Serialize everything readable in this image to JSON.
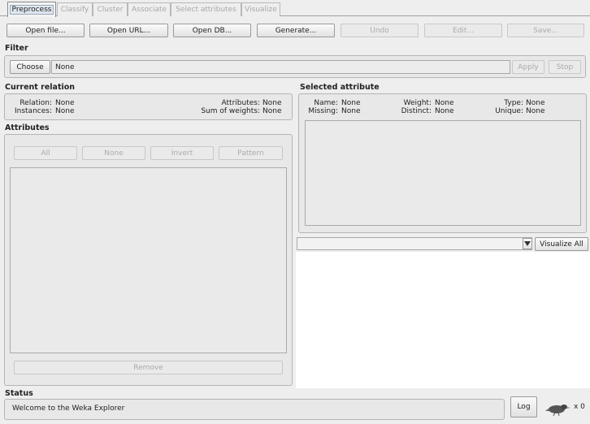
{
  "tabs": [
    "Preprocess",
    "Classify",
    "Cluster",
    "Associate",
    "Select attributes",
    "Visualize"
  ],
  "toolbar": {
    "open_file": "Open file...",
    "open_url": "Open URL...",
    "open_db": "Open DB...",
    "generate": "Generate...",
    "undo": "Undo",
    "edit": "Edit...",
    "save": "Save..."
  },
  "filter": {
    "title": "Filter",
    "choose": "Choose",
    "value": "None",
    "apply": "Apply",
    "stop": "Stop"
  },
  "current_relation": {
    "title": "Current relation",
    "relation_label": "Relation:",
    "relation_value": "None",
    "instances_label": "Instances:",
    "instances_value": "None",
    "attributes_label": "Attributes:",
    "attributes_value": "None",
    "sum_weights_label": "Sum of weights:",
    "sum_weights_value": "None"
  },
  "attributes": {
    "title": "Attributes",
    "all": "All",
    "none": "None",
    "invert": "Invert",
    "pattern": "Pattern",
    "remove": "Remove"
  },
  "selected_attribute": {
    "title": "Selected attribute",
    "name_label": "Name:",
    "name_value": "None",
    "weight_label": "Weight:",
    "weight_value": "None",
    "type_label": "Type:",
    "type_value": "None",
    "missing_label": "Missing:",
    "missing_value": "None",
    "distinct_label": "Distinct:",
    "distinct_value": "None",
    "unique_label": "Unique:",
    "unique_value": "None"
  },
  "visualize": {
    "visualize_all": "Visualize All"
  },
  "status": {
    "title": "Status",
    "message": "Welcome to the Weka Explorer",
    "log": "Log",
    "count": "x 0"
  },
  "icons": {
    "combo_arrow": "triangle-down-icon",
    "status_bird": "weka-bird-icon"
  }
}
